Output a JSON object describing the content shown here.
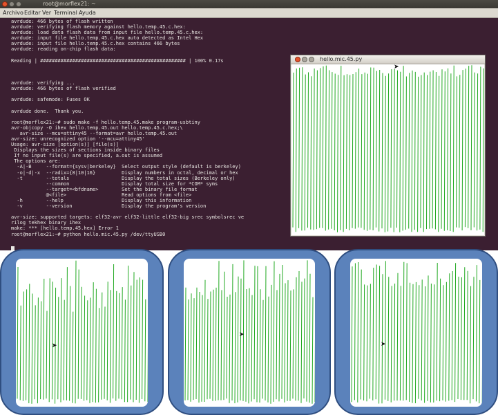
{
  "terminal": {
    "title": "root@morflex21: ~",
    "menu": [
      "Archivo",
      "Editar",
      "Ver",
      "Terminal",
      "Ayuda"
    ],
    "lines": [
      "avrdude: 466 bytes of flash written",
      "avrdude: verifying flash memory against hello.temp.45.c.hex:",
      "avrdude: load data flash data from input file hello.temp.45.c.hex:",
      "avrdude: input file hello.temp.45.c.hex auto detected as Intel Hex",
      "avrdude: input file hello.temp.45.c.hex contains 466 bytes",
      "avrdude: reading on-chip flash data:",
      "",
      "Reading | ################################################## | 100% 0.17s",
      "",
      "",
      "",
      "avrdude: verifying ...",
      "avrdude: 466 bytes of flash verified",
      "",
      "avrdude: safemode: Fuses OK",
      "",
      "avrdude done.  Thank you.",
      "",
      "root@morflex21:~# sudo make -f hello.temp.45.make program-usbtiny",
      "avr-objcopy -O ihex hello.temp.45.out hello.temp.45.c.hex;\\",
      "   avr-size --mcu=attiny45 --format=avr hello.temp.45.out",
      "avr-size: unrecognized option '--mcu=attiny45'",
      "Usage: avr-size [option(s)] [file(s)]",
      " Displays the sizes of sections inside binary files",
      " If no input file(s) are specified, a.out is assumed",
      " The options are:",
      "  -A|-B     --format={sysv|berkeley}  Select output style (default is berkeley)",
      "  -o|-d|-x  --radix={8|10|16}         Display numbers in octal, decimal or hex",
      "  -t        --totals                  Display the total sizes (Berkeley only)",
      "            --common                  Display total size for *COM* syms",
      "            --target=<bfdname>        Set the binary file format",
      "            @<file>                   Read options from <file>",
      "  -h        --help                    Display this information",
      "  -v        --version                 Display the program's version",
      "",
      "avr-size: supported targets: elf32-avr elf32-little elf32-big srec symbolsrec ve",
      "rilog tekhex binary ihex",
      "make: *** [hello.temp.45.hex] Error 1",
      "root@morflex21:~# python hello.mic.45.py /dev/ttyUSB0"
    ]
  },
  "plot_window": {
    "title": "hello.mic.45.py"
  },
  "colors": {
    "terminal_bg": "#3b1f31",
    "terminal_text": "#e8e6e2",
    "waveform": "#1fa81f",
    "panel_frame": "#5b82bb",
    "panel_border": "#2f4e80"
  },
  "icons": {
    "pointer": "mouse-pointer-icon"
  }
}
